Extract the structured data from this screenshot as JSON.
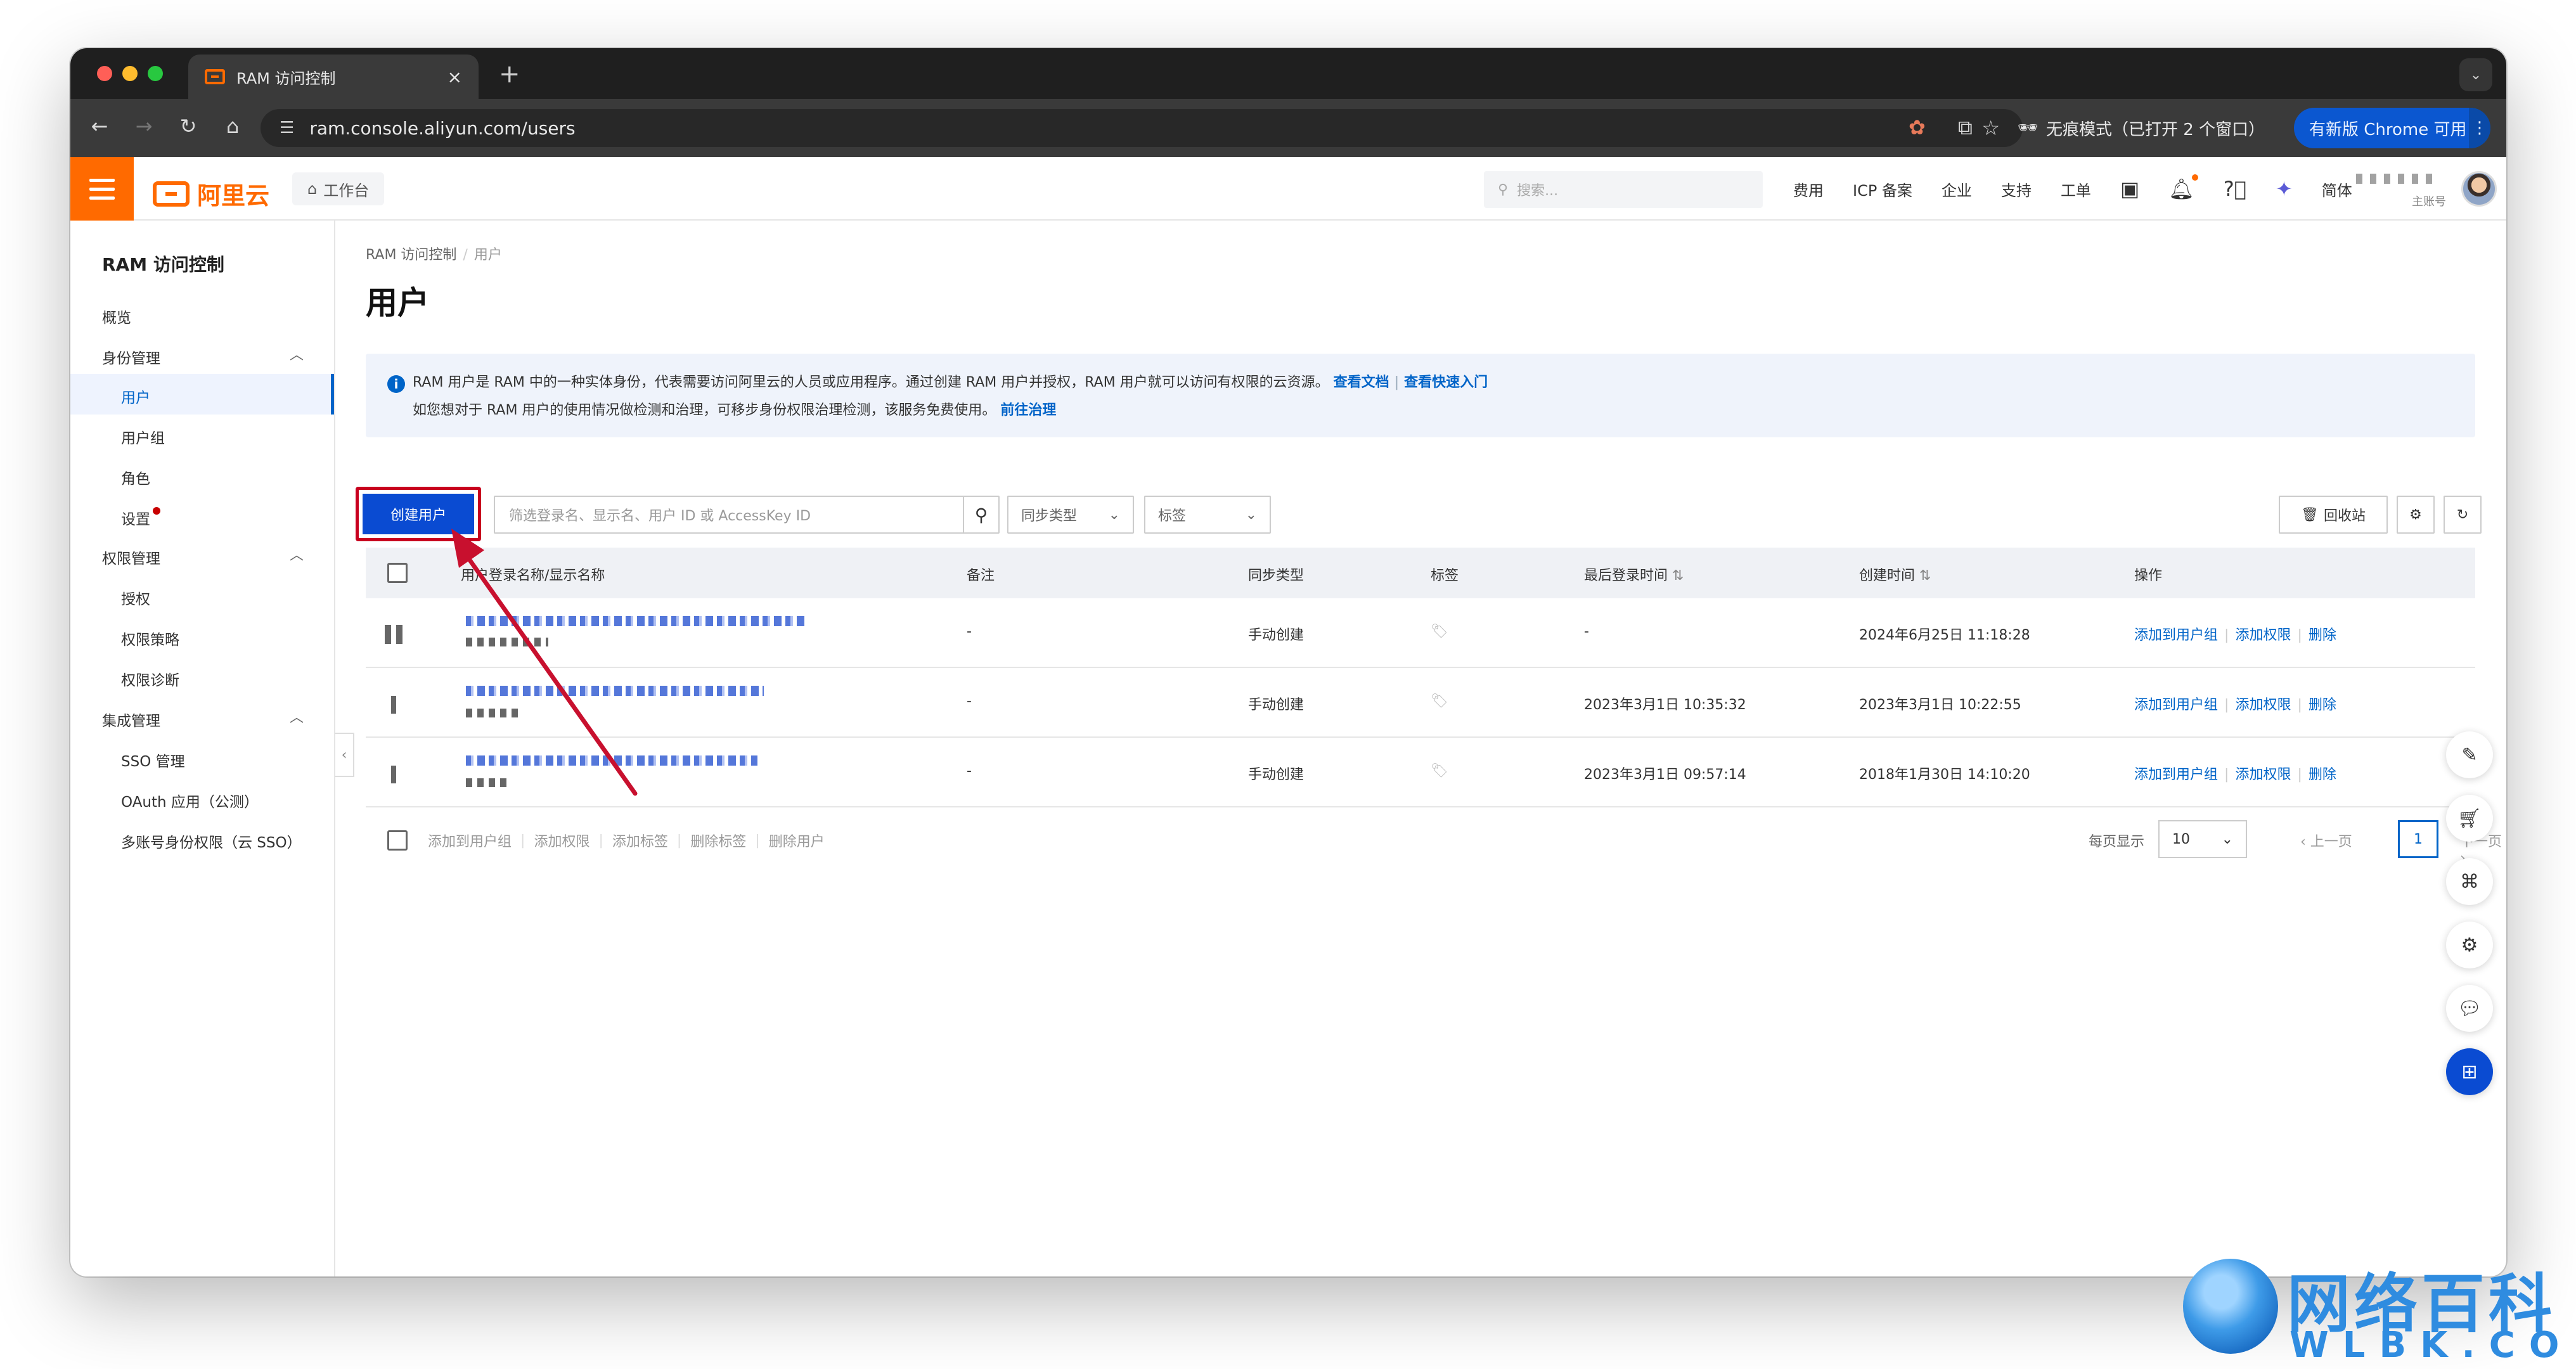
{
  "browser": {
    "tab_title": "RAM 访问控制",
    "new_tab": "+",
    "url": "ram.console.aliyun.com/users",
    "incognito_label": "无痕模式（已打开 2 个窗口）",
    "update_button": "有新版 Chrome 可用"
  },
  "header": {
    "logo_text": "阿里云",
    "workbench": "工作台",
    "search_placeholder": "搜索...",
    "nav": [
      "费用",
      "ICP 备案",
      "企业",
      "支持",
      "工单"
    ],
    "language": "简体",
    "account_role": "主账号",
    "accent_color": "#ff6a00"
  },
  "sidebar": {
    "title": "RAM 访问控制",
    "overview": "概览",
    "groups": [
      {
        "label": "身份管理",
        "items": [
          "用户",
          "用户组",
          "角色",
          "设置"
        ]
      },
      {
        "label": "权限管理",
        "items": [
          "授权",
          "权限策略",
          "权限诊断"
        ]
      },
      {
        "label": "集成管理",
        "items": [
          "SSO 管理",
          "OAuth 应用（公测）",
          "多账号身份权限（云 SSO）"
        ]
      }
    ],
    "active_item": "用户"
  },
  "main": {
    "breadcrumb": [
      "RAM 访问控制",
      "用户"
    ],
    "title": "用户",
    "notice": {
      "line1": "RAM 用户是 RAM 中的一种实体身份，代表需要访问阿里云的人员或应用程序。通过创建 RAM 用户并授权，RAM 用户就可以访问有权限的云资源。",
      "link1": "查看文档",
      "link2": "查看快速入门",
      "line2": "如您想对于 RAM 用户的使用情况做检测和治理，可移步身份权限治理检测，该服务免费使用。",
      "link3": "前往治理"
    },
    "create_button": "创建用户",
    "filter_placeholder": "筛选登录名、显示名、用户 ID 或 AccessKey ID",
    "sync_type_select": "同步类型",
    "tag_select": "标签",
    "recycle_button": "回收站",
    "columns": [
      "用户登录名称/显示名称",
      "备注",
      "同步类型",
      "标签",
      "最后登录时间",
      "创建时间",
      "操作"
    ],
    "rows": [
      {
        "remark": "-",
        "sync": "手动创建",
        "last_login": "-",
        "created": "2024年6月25日 11:18:28"
      },
      {
        "remark": "-",
        "sync": "手动创建",
        "last_login": "2023年3月1日 10:35:32",
        "created": "2023年3月1日 10:22:55"
      },
      {
        "remark": "-",
        "sync": "手动创建",
        "last_login": "2023年3月1日 09:57:14",
        "created": "2018年1月30日 14:10:20"
      }
    ],
    "row_actions": [
      "添加到用户组",
      "添加权限",
      "删除"
    ],
    "bulk_actions": [
      "添加到用户组",
      "添加权限",
      "添加标签",
      "删除标签",
      "删除用户"
    ],
    "pagination": {
      "per_page_label": "每页显示",
      "per_page": "10",
      "prev": "上一页",
      "page": "1",
      "next": "下一页"
    }
  },
  "watermark": {
    "cn": "网络百科",
    "en": "WLBK.COM"
  }
}
